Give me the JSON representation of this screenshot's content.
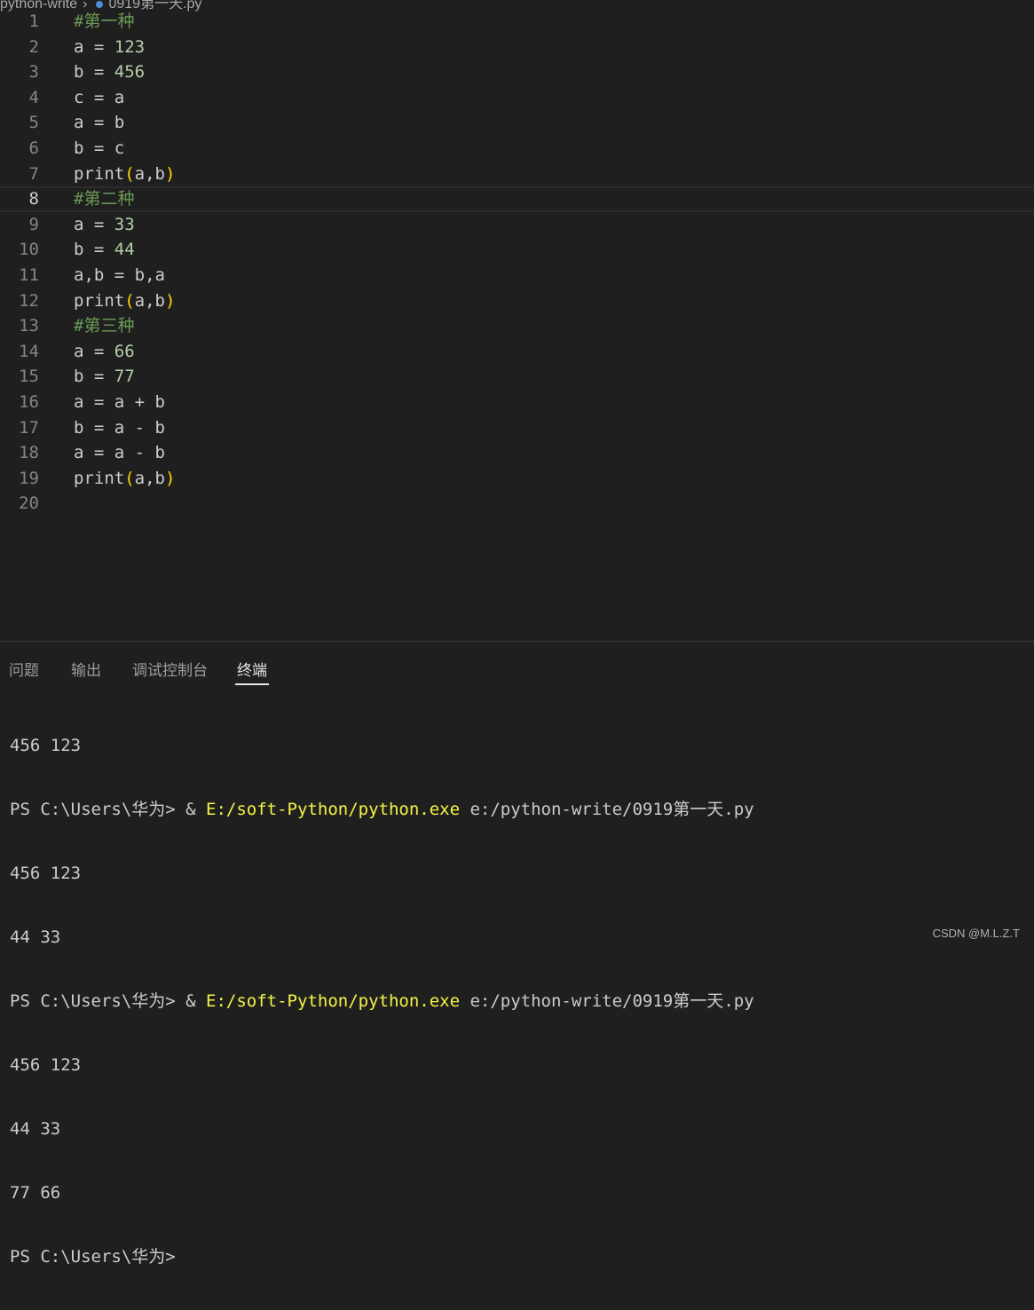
{
  "breadcrumb": {
    "folder": "python-write",
    "file": "0919第一天.py"
  },
  "editor": {
    "lines": [
      {
        "n": "1",
        "comment": "#第一种"
      },
      {
        "n": "2",
        "prefix": "a = ",
        "num": "123"
      },
      {
        "n": "3",
        "prefix": "b = ",
        "num": "456"
      },
      {
        "n": "4",
        "text": "c = a"
      },
      {
        "n": "5",
        "text": "a = b"
      },
      {
        "n": "6",
        "text": "b = c"
      },
      {
        "n": "7",
        "fn": "print",
        "args": "a,b"
      },
      {
        "n": "8",
        "comment": "#第二种"
      },
      {
        "n": "9",
        "prefix": "a = ",
        "num": "33"
      },
      {
        "n": "10",
        "prefix": "b = ",
        "num": "44"
      },
      {
        "n": "11",
        "text": "a,b = b,a"
      },
      {
        "n": "12",
        "fn": "print",
        "args": "a,b"
      },
      {
        "n": "13",
        "comment": "#第三种"
      },
      {
        "n": "14",
        "prefix": "a = ",
        "num": "66"
      },
      {
        "n": "15",
        "prefix": "b = ",
        "num": "77"
      },
      {
        "n": "16",
        "text": "a = a + b"
      },
      {
        "n": "17",
        "text": "b = a - b"
      },
      {
        "n": "18",
        "text": "a = a - b"
      },
      {
        "n": "19",
        "fn": "print",
        "args": "a,b"
      },
      {
        "n": "20",
        "text": ""
      }
    ],
    "current_line": "8"
  },
  "panel": {
    "tabs": [
      {
        "label": "问题",
        "active": false
      },
      {
        "label": "输出",
        "active": false
      },
      {
        "label": "调试控制台",
        "active": false
      },
      {
        "label": "终端",
        "active": true
      }
    ],
    "terminal": {
      "out1": "456 123",
      "prompt": "PS C:\\Users\\华为> ",
      "amp": "& ",
      "exe": "E:/soft-Python/python.exe",
      "script": " e:/python-write/0919第一天.py",
      "out2": "456 123",
      "out3": "44 33",
      "out4": "456 123",
      "out5": "44 33",
      "out6": "77 66",
      "final_prompt": "PS C:\\Users\\华为>"
    }
  },
  "watermark": "CSDN @M.L.Z.T",
  "colors": {
    "background": "#1f1f1f",
    "comment": "#6a9955",
    "number": "#b5cea8",
    "bracket": "#ffd700",
    "exe": "#f5f543"
  }
}
